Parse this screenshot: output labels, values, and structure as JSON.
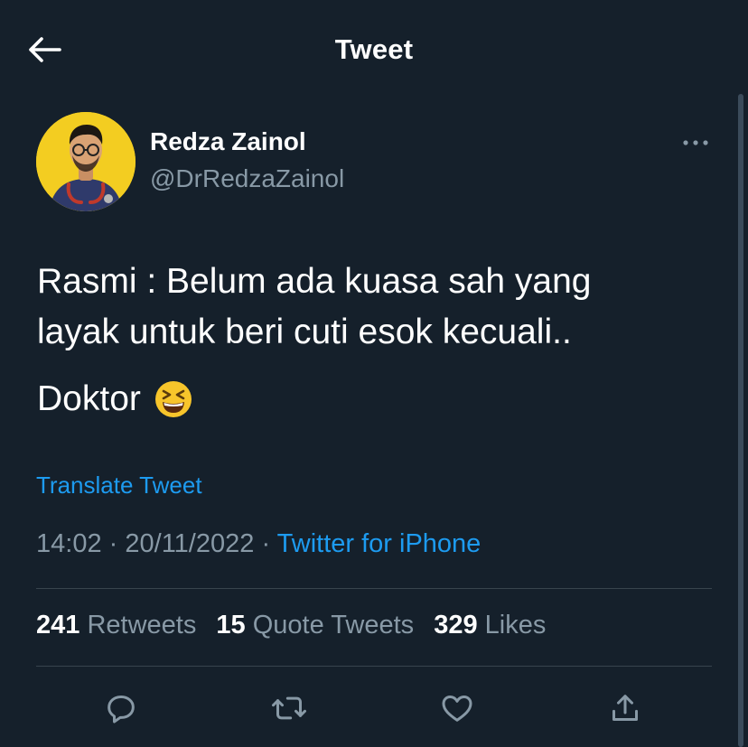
{
  "header": {
    "title": "Tweet",
    "back_icon": "arrow-left-icon"
  },
  "author": {
    "display_name": "Redza Zainol",
    "handle": "@DrRedzaZainol",
    "avatar_bg": "#f3cd21"
  },
  "tweet": {
    "lines": [
      "Rasmi : Belum ada kuasa sah yang",
      "layak untuk beri cuti esok kecuali.."
    ],
    "line3": "Doktor",
    "emoji": "grinning-squinting-face"
  },
  "translate_label": "Translate Tweet",
  "meta": {
    "time": "14:02",
    "date": "20/11/2022",
    "separator": "·",
    "source": "Twitter for iPhone"
  },
  "stats": {
    "retweets_count": "241",
    "retweets_label": "Retweets",
    "quotes_count": "15",
    "quotes_label": "Quote Tweets",
    "likes_count": "329",
    "likes_label": "Likes"
  },
  "actions": [
    "reply-icon",
    "retweet-icon",
    "like-icon",
    "share-icon"
  ],
  "colors": {
    "background": "#15202b",
    "accent": "#1d9bf0",
    "secondary_text": "#8899a6",
    "divider": "#38444d"
  }
}
